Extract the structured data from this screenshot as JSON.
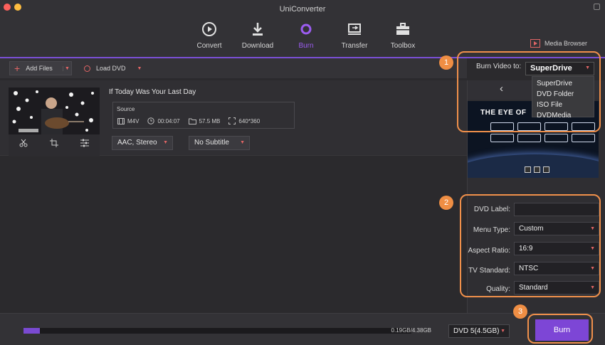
{
  "window": {
    "title": "UniConverter"
  },
  "nav": {
    "items": [
      {
        "label": "Convert",
        "icon": "convert-icon"
      },
      {
        "label": "Download",
        "icon": "download-icon"
      },
      {
        "label": "Burn",
        "icon": "burn-icon",
        "active": true
      },
      {
        "label": "Transfer",
        "icon": "transfer-icon"
      },
      {
        "label": "Toolbox",
        "icon": "toolbox-icon"
      }
    ],
    "media_browser": "Media Browser"
  },
  "toolbar": {
    "add_files": "Add Files",
    "load_dvd": "Load DVD"
  },
  "file": {
    "title": "If Today Was Your Last Day",
    "source_label": "Source",
    "format": "M4V",
    "duration": "00:04:07",
    "size": "57.5 MB",
    "resolution": "640*360",
    "audio": "AAC, Stereo",
    "subtitle": "No Subtitle"
  },
  "burn": {
    "burn_to_label": "Burn Video to:",
    "selected": "SuperDrive",
    "options": [
      "SuperDrive",
      "DVD Folder",
      "ISO File",
      "DVDMedia"
    ],
    "preview_title": "THE EYE OF"
  },
  "settings": {
    "dvd_label": {
      "label": "DVD Label:",
      "value": ""
    },
    "menu_type": {
      "label": "Menu Type:",
      "value": "Custom"
    },
    "aspect_ratio": {
      "label": "Aspect Ratio:",
      "value": "16:9"
    },
    "tv_standard": {
      "label": "TV Standard:",
      "value": "NTSC"
    },
    "quality": {
      "label": "Quality:",
      "value": "Standard"
    }
  },
  "bottom": {
    "progress_text": "0.19GB/4.38GB",
    "progress_fraction": 0.043,
    "dvd_type": "DVD 5(4.5GB)",
    "burn_button": "Burn"
  },
  "annotations": [
    "1",
    "2",
    "3"
  ],
  "colors": {
    "accent": "#7d46d6",
    "annotation": "#ef8e44",
    "arrow": "#e06565"
  }
}
